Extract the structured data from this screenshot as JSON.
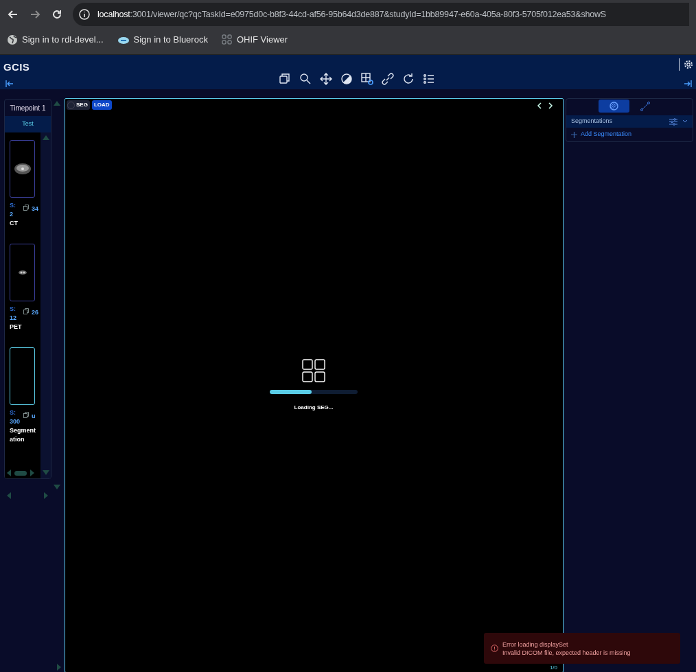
{
  "browser": {
    "url_host": "localhost",
    "url_rest": ":3001/viewer/qc?qcTaskId=e0975d0c-b8f3-44cd-af56-95b64d3de887&studyId=1bb89947-e60a-405a-80f3-5705f012ea53&showS",
    "bookmarks": [
      {
        "label": "Sign in to rdl-devel...",
        "kind": "globe"
      },
      {
        "label": "Sign in to Bluerock",
        "kind": "cloud"
      },
      {
        "label": "OHIF Viewer",
        "kind": "grid"
      }
    ]
  },
  "app": {
    "title": "GCIS"
  },
  "study_panel": {
    "timepoint": "Timepoint 1",
    "tab": {
      "label": "Test",
      "selected": true
    },
    "thumbnails": [
      {
        "series_label": "S:",
        "series_number": "2",
        "modality": "CT",
        "count": "34",
        "selected": false,
        "kind": "ct"
      },
      {
        "series_label": "S:",
        "series_number": "12",
        "modality": "PET",
        "count": "26",
        "selected": false,
        "kind": "pet"
      },
      {
        "series_label": "S:",
        "series_number": "300",
        "modality": "Segment ation",
        "count": "u",
        "selected": true,
        "kind": "empty"
      }
    ]
  },
  "viewport": {
    "seg_badge": "SEG",
    "load_button": "LOAD",
    "loading": {
      "level": 0.48,
      "text": "Loading SEG..."
    },
    "counter": "1/0"
  },
  "segmentation_panel": {
    "tabs": [
      {
        "kind": "segmentation",
        "selected": true
      },
      {
        "kind": "measurement",
        "selected": false
      }
    ],
    "header": "Segmentations",
    "add_label": "Add Segmentation"
  },
  "toast": {
    "title": "Error loading displaySet",
    "message": "Invalid DICOM file, expected header is missing"
  }
}
